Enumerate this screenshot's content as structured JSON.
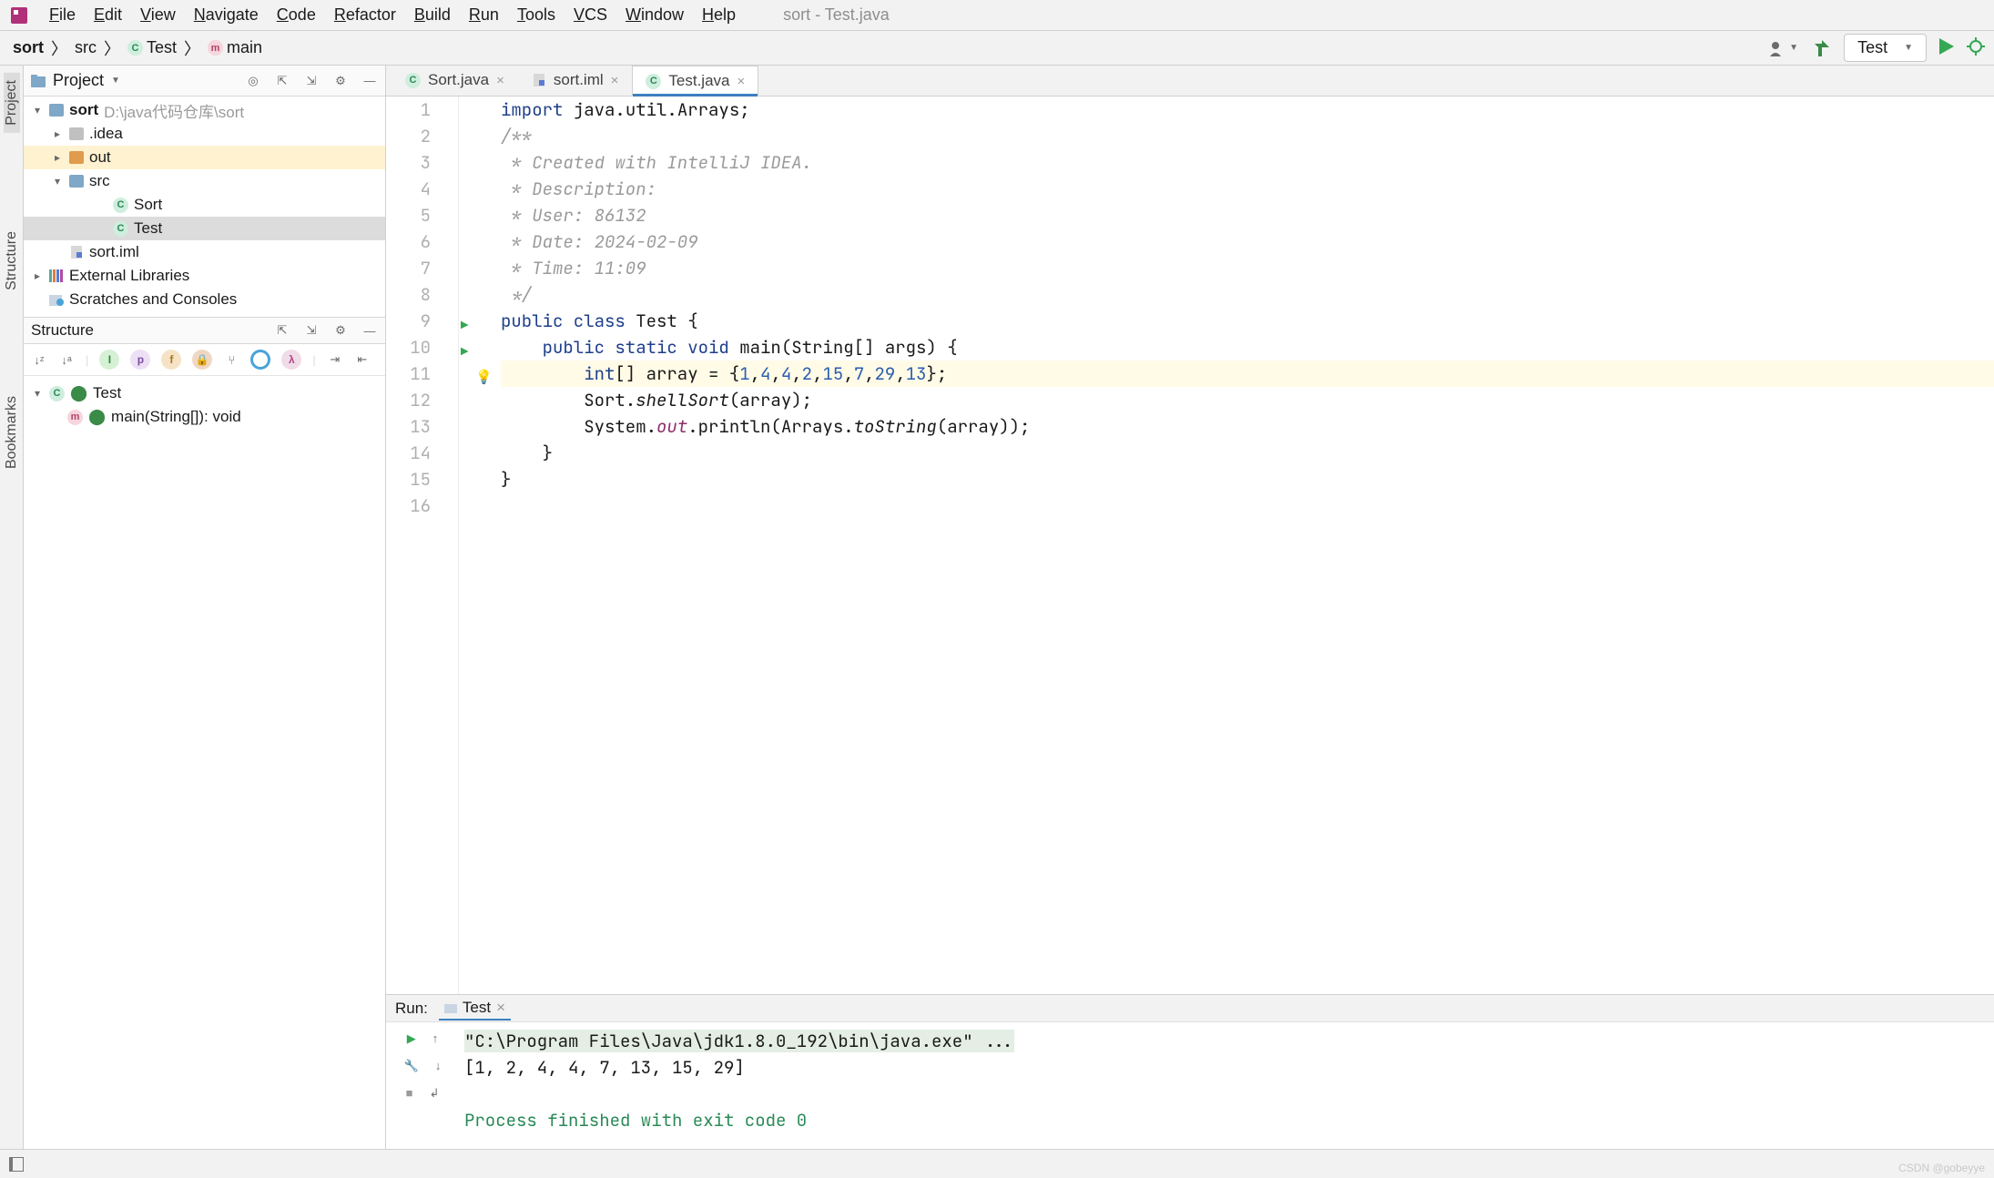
{
  "window_title": "sort - Test.java",
  "menu": [
    "File",
    "Edit",
    "View",
    "Navigate",
    "Code",
    "Refactor",
    "Build",
    "Run",
    "Tools",
    "VCS",
    "Window",
    "Help"
  ],
  "breadcrumbs": [
    {
      "label": "sort",
      "icon": ""
    },
    {
      "label": "src",
      "icon": ""
    },
    {
      "label": "Test",
      "icon": "c"
    },
    {
      "label": "main",
      "icon": "m"
    }
  ],
  "run_config_selected": "Test",
  "project": {
    "title": "Project",
    "root": {
      "name": "sort",
      "path": "D:\\java代码仓库\\sort"
    },
    "items": [
      {
        "name": ".idea",
        "type": "folder-grey",
        "expand": "closed",
        "indent": 1
      },
      {
        "name": "out",
        "type": "folder-or",
        "expand": "closed",
        "indent": 1,
        "highlight": true
      },
      {
        "name": "src",
        "type": "folder-blue",
        "expand": "open",
        "indent": 1
      },
      {
        "name": "Sort",
        "type": "class",
        "indent": 3
      },
      {
        "name": "Test",
        "type": "class",
        "indent": 3,
        "selected": true
      },
      {
        "name": "sort.iml",
        "type": "iml",
        "indent": 1
      }
    ],
    "external": "External Libraries",
    "scratches": "Scratches and Consoles"
  },
  "structure": {
    "title": "Structure",
    "class": "Test",
    "method": "main(String[]): void"
  },
  "tabs": [
    {
      "label": "Sort.java",
      "icon": "c"
    },
    {
      "label": "sort.iml",
      "icon": "iml"
    },
    {
      "label": "Test.java",
      "icon": "c",
      "active": true
    }
  ],
  "code": {
    "lines": [
      {
        "n": 1,
        "segs": [
          {
            "t": "import ",
            "c": "k-key"
          },
          {
            "t": "java.util.Arrays;"
          }
        ]
      },
      {
        "n": 2,
        "segs": [
          {
            "t": "/**",
            "c": "k-com"
          }
        ]
      },
      {
        "n": 3,
        "segs": [
          {
            "t": " * Created with IntelliJ IDEA.",
            "c": "k-com"
          }
        ]
      },
      {
        "n": 4,
        "segs": [
          {
            "t": " * Description:",
            "c": "k-com"
          }
        ]
      },
      {
        "n": 5,
        "segs": [
          {
            "t": " * User: 86132",
            "c": "k-com"
          }
        ]
      },
      {
        "n": 6,
        "segs": [
          {
            "t": " * Date: 2024-02-09",
            "c": "k-com"
          }
        ]
      },
      {
        "n": 7,
        "segs": [
          {
            "t": " * Time: 11:09",
            "c": "k-com"
          }
        ]
      },
      {
        "n": 8,
        "segs": [
          {
            "t": " */",
            "c": "k-com"
          }
        ]
      },
      {
        "n": 9,
        "run": true,
        "segs": [
          {
            "t": "public class ",
            "c": "k-key"
          },
          {
            "t": "Test {"
          }
        ]
      },
      {
        "n": 10,
        "run": true,
        "segs": [
          {
            "t": "    "
          },
          {
            "t": "public static void ",
            "c": "k-key"
          },
          {
            "t": "main"
          },
          {
            "t": "(String[] args) {"
          }
        ]
      },
      {
        "n": 11,
        "hl": true,
        "bulb": true,
        "segs": [
          {
            "t": "        "
          },
          {
            "t": "int",
            "c": "k-key"
          },
          {
            "t": "[] array = {"
          },
          {
            "t": "1",
            "c": "k-num"
          },
          {
            "t": ","
          },
          {
            "t": "4",
            "c": "k-num"
          },
          {
            "t": ","
          },
          {
            "t": "4",
            "c": "k-num"
          },
          {
            "t": ","
          },
          {
            "t": "2",
            "c": "k-num"
          },
          {
            "t": ","
          },
          {
            "t": "15",
            "c": "k-num"
          },
          {
            "t": ","
          },
          {
            "t": "7",
            "c": "k-num"
          },
          {
            "t": ","
          },
          {
            "t": "29",
            "c": "k-num"
          },
          {
            "t": ","
          },
          {
            "t": "13",
            "c": "k-num"
          },
          {
            "t": "};"
          }
        ]
      },
      {
        "n": 12,
        "segs": [
          {
            "t": "        Sort."
          },
          {
            "t": "shellSort",
            "c": "k-call"
          },
          {
            "t": "(array);"
          }
        ]
      },
      {
        "n": 13,
        "segs": [
          {
            "t": "        System."
          },
          {
            "t": "out",
            "c": "k-out"
          },
          {
            "t": ".println(Arrays."
          },
          {
            "t": "toString",
            "c": "k-call"
          },
          {
            "t": "(array));"
          }
        ]
      },
      {
        "n": 14,
        "segs": [
          {
            "t": "    }"
          }
        ]
      },
      {
        "n": 15,
        "segs": [
          {
            "t": "}"
          }
        ]
      },
      {
        "n": 16,
        "segs": [
          {
            "t": ""
          }
        ]
      }
    ]
  },
  "run_panel": {
    "title": "Run:",
    "tab": "Test",
    "cmd": "\"C:\\Program Files\\Java\\jdk1.8.0_192\\bin\\java.exe\" ...",
    "out": "[1, 2, 4, 4, 7, 13, 15, 29]",
    "exit": "Process finished with exit code 0"
  },
  "left_tabs": [
    "Project",
    "Structure",
    "Bookmarks"
  ],
  "watermark": "CSDN @gobeyye"
}
